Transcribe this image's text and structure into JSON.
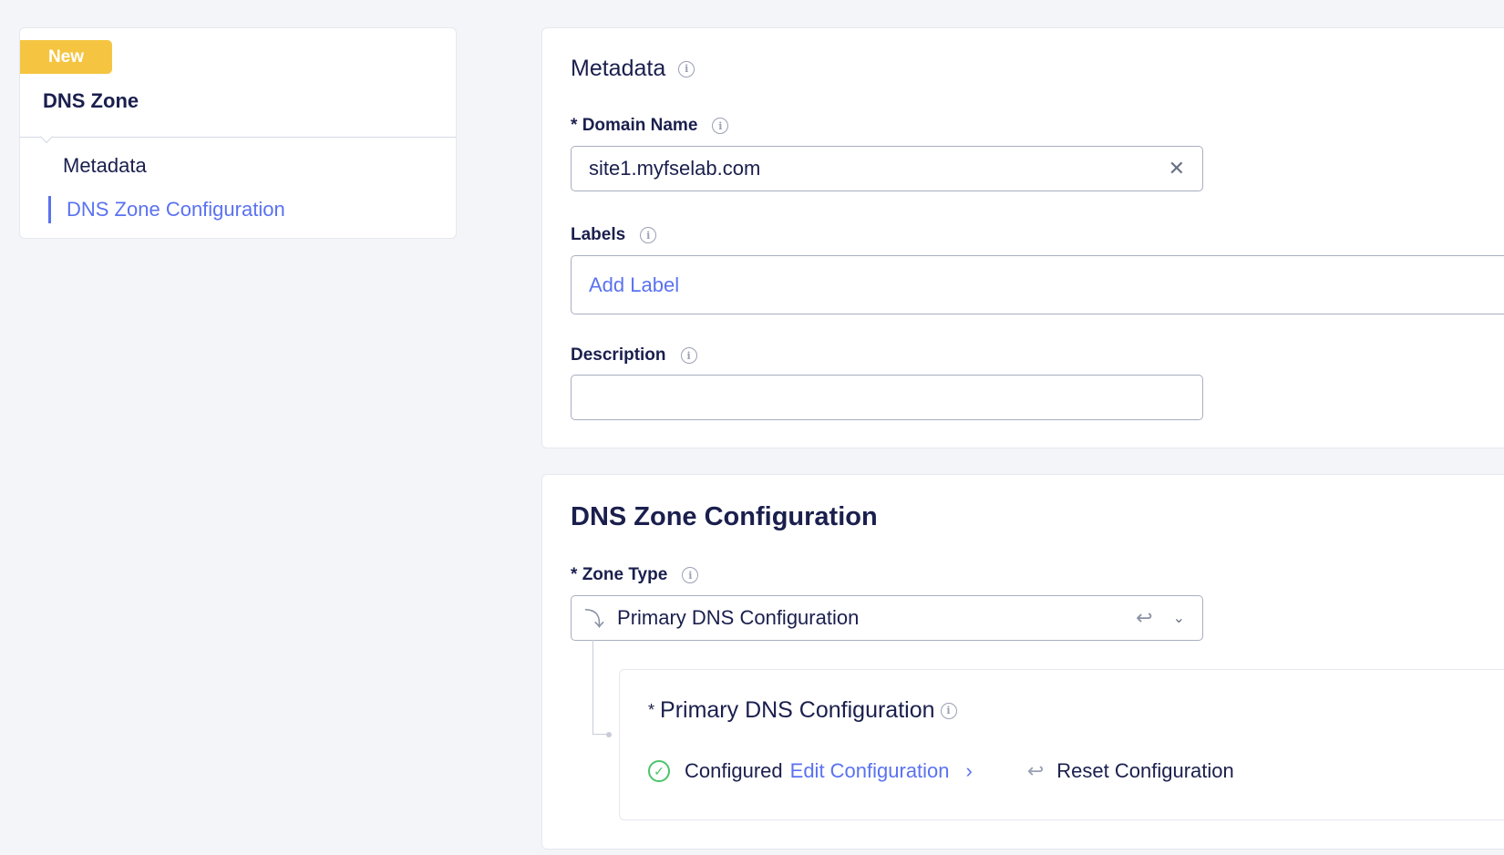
{
  "sidebar": {
    "badge": "New",
    "title": "DNS Zone",
    "items": [
      {
        "label": "Metadata"
      },
      {
        "label": "DNS Zone Configuration",
        "active": true
      }
    ]
  },
  "metadata": {
    "heading": "Metadata",
    "domain_label": "Domain Name",
    "domain_value": "site1.myfselab.com",
    "labels_label": "Labels",
    "add_label": "Add Label",
    "description_label": "Description",
    "description_value": ""
  },
  "config": {
    "heading": "DNS Zone Configuration",
    "zone_type_label": "Zone Type",
    "zone_type_value": "Primary DNS Configuration",
    "sub_heading": "Primary DNS Configuration",
    "status": "Configured",
    "edit": "Edit Configuration",
    "reset": "Reset Configuration"
  },
  "colors": {
    "accent": "#5a72f0",
    "badge": "#f5c542",
    "success": "#4cc46a"
  }
}
